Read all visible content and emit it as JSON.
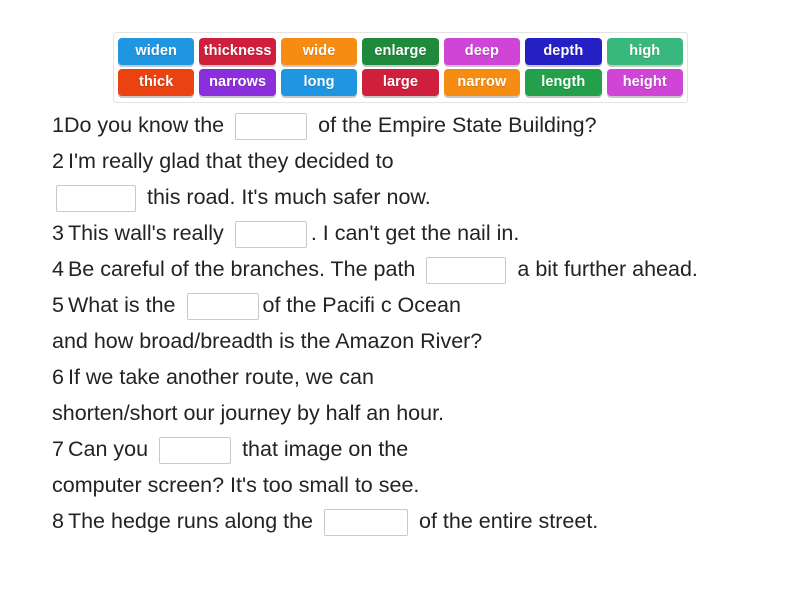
{
  "word_bank": {
    "rows": [
      [
        {
          "label": "widen",
          "color": "#2196e0"
        },
        {
          "label": "thickness",
          "color": "#cf1f3c"
        },
        {
          "label": "wide",
          "color": "#f78c13"
        },
        {
          "label": "enlarge",
          "color": "#1f8a3c"
        },
        {
          "label": "deep",
          "color": "#cf45d6"
        },
        {
          "label": "depth",
          "color": "#2520c4"
        },
        {
          "label": "high",
          "color": "#39b87e"
        }
      ],
      [
        {
          "label": "thick",
          "color": "#ea4211"
        },
        {
          "label": "narrows",
          "color": "#8b2fdc"
        },
        {
          "label": "long",
          "color": "#2196e0"
        },
        {
          "label": "large",
          "color": "#cf1f3c"
        },
        {
          "label": "narrow",
          "color": "#f78c13"
        },
        {
          "label": "length",
          "color": "#24a04d"
        },
        {
          "label": "height",
          "color": "#cf45d6"
        }
      ]
    ]
  },
  "sentences": {
    "line1": {
      "num": "1",
      "before": "Do you know the",
      "after": "of the Empire State Building?"
    },
    "line2a": {
      "num": "2",
      "text": "I'm really glad that they decided to"
    },
    "line2b": {
      "after": "this road. It's much safer now."
    },
    "line3": {
      "num": "3",
      "before": "This wall's really",
      "after": ". I can't get the nail in."
    },
    "line4": {
      "num": "4",
      "before": "Be careful of the branches. The path",
      "after": "a bit further ahead."
    },
    "line5a": {
      "num": "5",
      "before": "What is the",
      "after": "of the Pacifi c Ocean"
    },
    "line5b": {
      "text": "and how broad/breadth is the Amazon River?"
    },
    "line6a": {
      "num": "6",
      "text": "If we take another route, we can"
    },
    "line6b": {
      "text": "shorten/short our journey by half an hour."
    },
    "line7a": {
      "num": "7",
      "before": "Can you",
      "after": "that image on the"
    },
    "line7b": {
      "text": "computer screen? It's too small to see."
    },
    "line8": {
      "num": "8",
      "before": "The hedge runs along the",
      "after": "of the entire street."
    }
  }
}
